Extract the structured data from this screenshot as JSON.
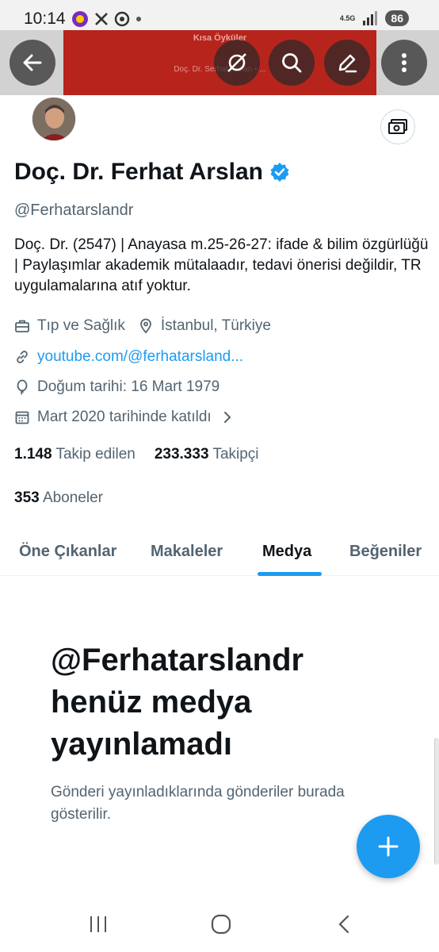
{
  "status_bar": {
    "time": "10:14",
    "network": "4.5G",
    "battery": "86"
  },
  "banner": {
    "line1": "Kısa Öyküler",
    "line2": "Doç. Dr. Serhat Arslan • ..."
  },
  "profile": {
    "name": "Doç. Dr. Ferhat Arslan",
    "handle": "@Ferhatarslandr",
    "bio": "Doç. Dr. (2547) | Anayasa m.25-26-27: ifade & bilim özgürlüğü | Paylaşımlar akademik mütalaadır, tedavi önerisi değildir, TR uygulamalarına atıf yoktur.",
    "category": "Tıp ve Sağlık",
    "location": "İstanbul, Türkiye",
    "link": "youtube.com/@ferhatarsland...",
    "birthday": "Doğum tarihi: 16 Mart 1979",
    "joined": "Mart 2020 tarihinde katıldı"
  },
  "stats": {
    "following_count": "1.148",
    "following_label": "Takip edilen",
    "followers_count": "233.333",
    "followers_label": "Takipçi",
    "subscribers_count": "353",
    "subscribers_label": "Aboneler"
  },
  "tabs": [
    {
      "label": "Öne Çıkanlar"
    },
    {
      "label": "Makaleler"
    },
    {
      "label": "Medya",
      "active": true
    },
    {
      "label": "Beğeniler"
    }
  ],
  "empty_state": {
    "title": "@Ferhatarslandr henüz medya yayınlamadı",
    "subtitle": "Gönderi yayınladıklarında gönderiler burada gösterilir."
  },
  "colors": {
    "accent": "#1d9bf0",
    "text_primary": "#0f1419",
    "text_secondary": "#536471",
    "banner_red": "#b7241c"
  },
  "icons": [
    "back-arrow-icon",
    "grok-icon",
    "search-icon",
    "edit-icon",
    "more-vertical-icon",
    "tip-money-icon",
    "verified-badge-icon",
    "briefcase-icon",
    "location-pin-icon",
    "link-icon",
    "balloon-icon",
    "calendar-icon",
    "chevron-right-icon",
    "plus-icon"
  ]
}
